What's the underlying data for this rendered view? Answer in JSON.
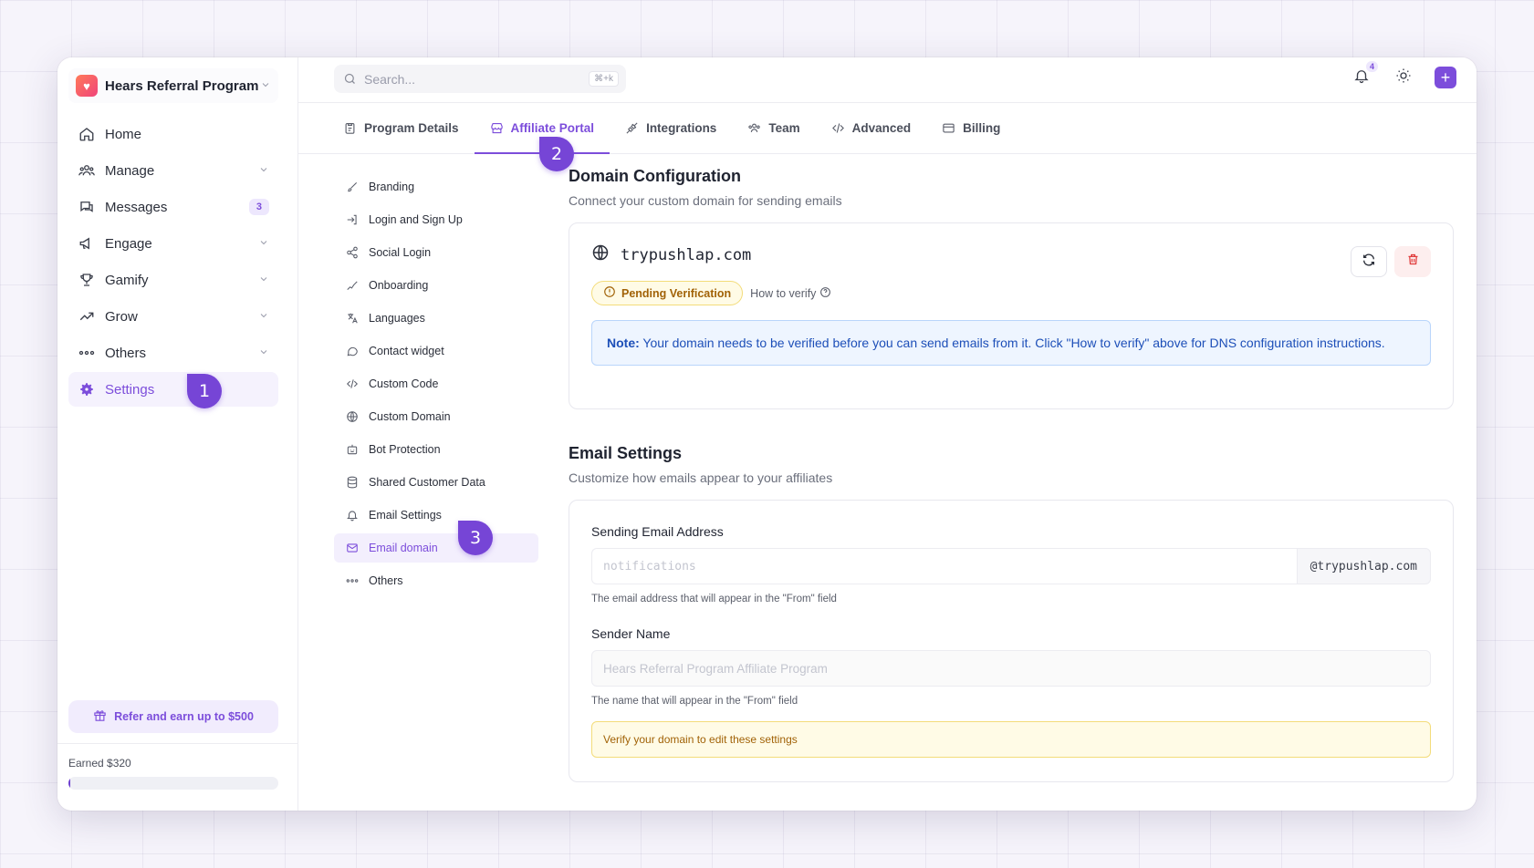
{
  "workspace": {
    "name": "Hears Referral Program"
  },
  "sidebar": {
    "items": [
      {
        "label": "Home",
        "icon": "home-icon"
      },
      {
        "label": "Manage",
        "icon": "users-icon",
        "chevron": true
      },
      {
        "label": "Messages",
        "icon": "messages-icon",
        "badge": "3"
      },
      {
        "label": "Engage",
        "icon": "megaphone-icon",
        "chevron": true
      },
      {
        "label": "Gamify",
        "icon": "trophy-icon",
        "chevron": true
      },
      {
        "label": "Grow",
        "icon": "trending-up-icon",
        "chevron": true
      },
      {
        "label": "Others",
        "icon": "dots-icon",
        "chevron": true
      },
      {
        "label": "Settings",
        "icon": "gear-icon",
        "active": true
      }
    ],
    "refer_label": "Refer and earn up to $500",
    "earned_label": "Earned $320",
    "earned_progress": 0.01
  },
  "search": {
    "placeholder": "Search...",
    "shortcut": "⌘+k"
  },
  "notifications": {
    "count": "4"
  },
  "tabs": [
    {
      "label": "Program Details"
    },
    {
      "label": "Affiliate Portal",
      "active": true
    },
    {
      "label": "Integrations"
    },
    {
      "label": "Team"
    },
    {
      "label": "Advanced"
    },
    {
      "label": "Billing"
    }
  ],
  "subnav": [
    "Branding",
    "Login and Sign Up",
    "Social Login",
    "Onboarding",
    "Languages",
    "Contact widget",
    "Custom Code",
    "Custom Domain",
    "Bot Protection",
    "Shared Customer Data",
    "Email Settings",
    "Email domain",
    "Others"
  ],
  "domain_config": {
    "title": "Domain Configuration",
    "subtitle": "Connect your custom domain for sending emails",
    "domain": "trypushlap.com",
    "status": "Pending Verification",
    "how_to_verify": "How to verify",
    "note_label": "Note:",
    "note_text": "Your domain needs to be verified before you can send emails from it. Click \"How to verify\" above for DNS configuration instructions."
  },
  "email_settings": {
    "title": "Email Settings",
    "subtitle": "Customize how emails appear to your affiliates",
    "sending_label": "Sending Email Address",
    "sending_placeholder": "notifications",
    "sending_suffix": "@trypushlap.com",
    "sending_help": "The email address that will appear in the \"From\" field",
    "sender_name_label": "Sender Name",
    "sender_name_placeholder": "Hears Referral Program Affiliate Program",
    "sender_name_help": "The name that will appear in the \"From\" field",
    "warning": "Verify your domain to edit these settings"
  },
  "markers": [
    "1",
    "2",
    "3"
  ],
  "colors": {
    "accent": "#7c4ddb",
    "warning": "#a16207",
    "info": "#1d4fb8",
    "danger": "#e03a3a"
  }
}
